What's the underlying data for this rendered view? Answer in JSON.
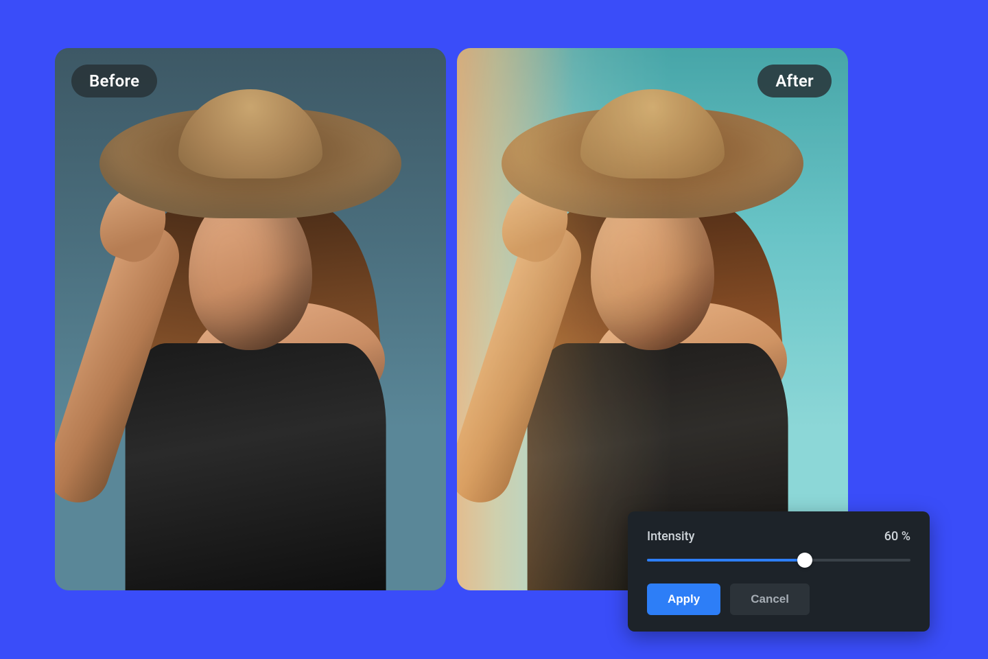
{
  "compare": {
    "before_label": "Before",
    "after_label": "After"
  },
  "panel": {
    "slider_label": "Intensity",
    "slider_value_display": "60 %",
    "slider_percent": 60,
    "apply_label": "Apply",
    "cancel_label": "Cancel"
  },
  "colors": {
    "background": "#3a4df9",
    "panel_bg": "#1d2329",
    "accent": "#2d7ef7"
  }
}
